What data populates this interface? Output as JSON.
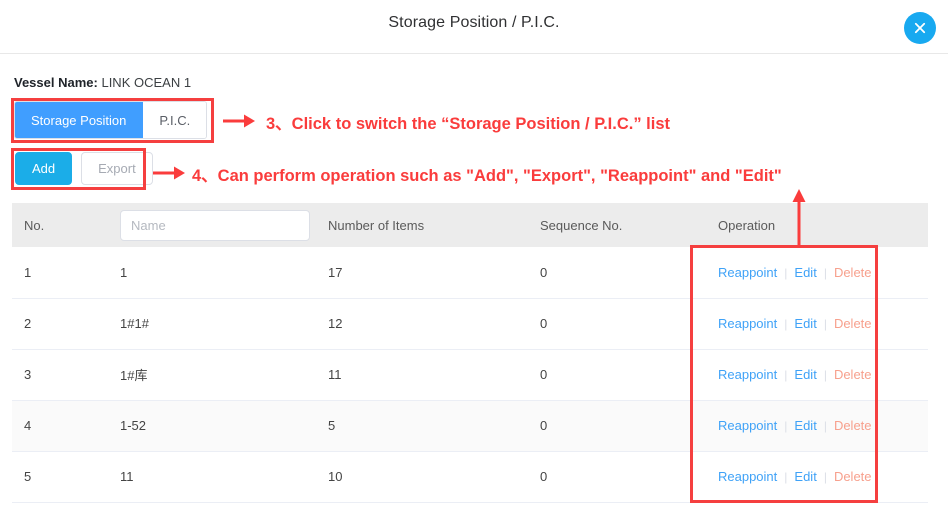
{
  "dialog": {
    "title": "Storage Position / P.I.C.",
    "close_icon": "close-circle-icon"
  },
  "vessel": {
    "label": "Vessel Name:",
    "value": "LINK OCEAN 1"
  },
  "tabs": [
    {
      "label": "Storage Position",
      "active": true
    },
    {
      "label": "P.I.C.",
      "active": false
    }
  ],
  "actions": {
    "add_label": "Add",
    "export_label": "Export"
  },
  "table": {
    "headers": {
      "no": "No.",
      "name": "Name",
      "items": "Number of Items",
      "sequence": "Sequence No.",
      "operation": "Operation"
    },
    "name_search": {
      "value": "",
      "placeholder": "Name"
    },
    "op_labels": {
      "reappoint": "Reappoint",
      "edit": "Edit",
      "delete": "Delete",
      "separator": "|"
    },
    "rows": [
      {
        "no": "1",
        "name": "1",
        "items": "17",
        "sequence": "0",
        "striped": false
      },
      {
        "no": "2",
        "name": "1#1#",
        "items": "12",
        "sequence": "0",
        "striped": false
      },
      {
        "no": "3",
        "name": "1#库",
        "items": "11",
        "sequence": "0",
        "striped": false
      },
      {
        "no": "4",
        "name": "1-52",
        "items": "5",
        "sequence": "0",
        "striped": true
      },
      {
        "no": "5",
        "name": "11",
        "items": "10",
        "sequence": "0",
        "striped": false
      }
    ]
  },
  "annotations": {
    "step3": "3、Click to switch the  “Storage Position / P.I.C.”  list",
    "step4": "4、Can perform operation such as \"Add\", \"Export\", \"Reappoint\" and \"Edit\""
  },
  "colors": {
    "annotation_red": "#fa3c3c",
    "tab_active_blue": "#409eff",
    "add_button_blue": "#1bade8",
    "close_button_blue": "#18a9f0",
    "link_blue": "#3fa2f7",
    "delete_disabled": "#f7a08d",
    "header_gray": "#ececec"
  }
}
